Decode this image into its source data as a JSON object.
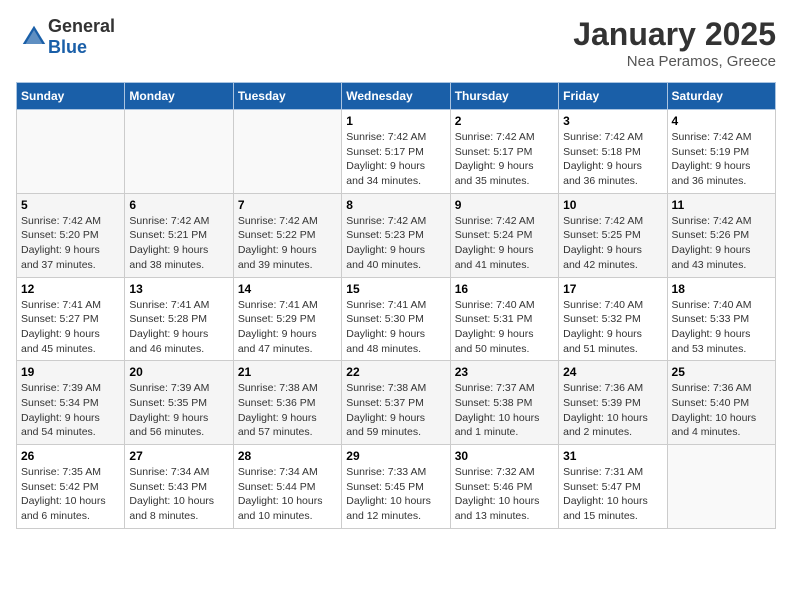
{
  "header": {
    "logo": {
      "text_general": "General",
      "text_blue": "Blue"
    },
    "title": "January 2025",
    "location": "Nea Peramos, Greece"
  },
  "weekdays": [
    "Sunday",
    "Monday",
    "Tuesday",
    "Wednesday",
    "Thursday",
    "Friday",
    "Saturday"
  ],
  "weeks": [
    [
      {
        "day": "",
        "info": ""
      },
      {
        "day": "",
        "info": ""
      },
      {
        "day": "",
        "info": ""
      },
      {
        "day": "1",
        "info": "Sunrise: 7:42 AM\nSunset: 5:17 PM\nDaylight: 9 hours\nand 34 minutes."
      },
      {
        "day": "2",
        "info": "Sunrise: 7:42 AM\nSunset: 5:17 PM\nDaylight: 9 hours\nand 35 minutes."
      },
      {
        "day": "3",
        "info": "Sunrise: 7:42 AM\nSunset: 5:18 PM\nDaylight: 9 hours\nand 36 minutes."
      },
      {
        "day": "4",
        "info": "Sunrise: 7:42 AM\nSunset: 5:19 PM\nDaylight: 9 hours\nand 36 minutes."
      }
    ],
    [
      {
        "day": "5",
        "info": "Sunrise: 7:42 AM\nSunset: 5:20 PM\nDaylight: 9 hours\nand 37 minutes."
      },
      {
        "day": "6",
        "info": "Sunrise: 7:42 AM\nSunset: 5:21 PM\nDaylight: 9 hours\nand 38 minutes."
      },
      {
        "day": "7",
        "info": "Sunrise: 7:42 AM\nSunset: 5:22 PM\nDaylight: 9 hours\nand 39 minutes."
      },
      {
        "day": "8",
        "info": "Sunrise: 7:42 AM\nSunset: 5:23 PM\nDaylight: 9 hours\nand 40 minutes."
      },
      {
        "day": "9",
        "info": "Sunrise: 7:42 AM\nSunset: 5:24 PM\nDaylight: 9 hours\nand 41 minutes."
      },
      {
        "day": "10",
        "info": "Sunrise: 7:42 AM\nSunset: 5:25 PM\nDaylight: 9 hours\nand 42 minutes."
      },
      {
        "day": "11",
        "info": "Sunrise: 7:42 AM\nSunset: 5:26 PM\nDaylight: 9 hours\nand 43 minutes."
      }
    ],
    [
      {
        "day": "12",
        "info": "Sunrise: 7:41 AM\nSunset: 5:27 PM\nDaylight: 9 hours\nand 45 minutes."
      },
      {
        "day": "13",
        "info": "Sunrise: 7:41 AM\nSunset: 5:28 PM\nDaylight: 9 hours\nand 46 minutes."
      },
      {
        "day": "14",
        "info": "Sunrise: 7:41 AM\nSunset: 5:29 PM\nDaylight: 9 hours\nand 47 minutes."
      },
      {
        "day": "15",
        "info": "Sunrise: 7:41 AM\nSunset: 5:30 PM\nDaylight: 9 hours\nand 48 minutes."
      },
      {
        "day": "16",
        "info": "Sunrise: 7:40 AM\nSunset: 5:31 PM\nDaylight: 9 hours\nand 50 minutes."
      },
      {
        "day": "17",
        "info": "Sunrise: 7:40 AM\nSunset: 5:32 PM\nDaylight: 9 hours\nand 51 minutes."
      },
      {
        "day": "18",
        "info": "Sunrise: 7:40 AM\nSunset: 5:33 PM\nDaylight: 9 hours\nand 53 minutes."
      }
    ],
    [
      {
        "day": "19",
        "info": "Sunrise: 7:39 AM\nSunset: 5:34 PM\nDaylight: 9 hours\nand 54 minutes."
      },
      {
        "day": "20",
        "info": "Sunrise: 7:39 AM\nSunset: 5:35 PM\nDaylight: 9 hours\nand 56 minutes."
      },
      {
        "day": "21",
        "info": "Sunrise: 7:38 AM\nSunset: 5:36 PM\nDaylight: 9 hours\nand 57 minutes."
      },
      {
        "day": "22",
        "info": "Sunrise: 7:38 AM\nSunset: 5:37 PM\nDaylight: 9 hours\nand 59 minutes."
      },
      {
        "day": "23",
        "info": "Sunrise: 7:37 AM\nSunset: 5:38 PM\nDaylight: 10 hours\nand 1 minute."
      },
      {
        "day": "24",
        "info": "Sunrise: 7:36 AM\nSunset: 5:39 PM\nDaylight: 10 hours\nand 2 minutes."
      },
      {
        "day": "25",
        "info": "Sunrise: 7:36 AM\nSunset: 5:40 PM\nDaylight: 10 hours\nand 4 minutes."
      }
    ],
    [
      {
        "day": "26",
        "info": "Sunrise: 7:35 AM\nSunset: 5:42 PM\nDaylight: 10 hours\nand 6 minutes."
      },
      {
        "day": "27",
        "info": "Sunrise: 7:34 AM\nSunset: 5:43 PM\nDaylight: 10 hours\nand 8 minutes."
      },
      {
        "day": "28",
        "info": "Sunrise: 7:34 AM\nSunset: 5:44 PM\nDaylight: 10 hours\nand 10 minutes."
      },
      {
        "day": "29",
        "info": "Sunrise: 7:33 AM\nSunset: 5:45 PM\nDaylight: 10 hours\nand 12 minutes."
      },
      {
        "day": "30",
        "info": "Sunrise: 7:32 AM\nSunset: 5:46 PM\nDaylight: 10 hours\nand 13 minutes."
      },
      {
        "day": "31",
        "info": "Sunrise: 7:31 AM\nSunset: 5:47 PM\nDaylight: 10 hours\nand 15 minutes."
      },
      {
        "day": "",
        "info": ""
      }
    ]
  ]
}
